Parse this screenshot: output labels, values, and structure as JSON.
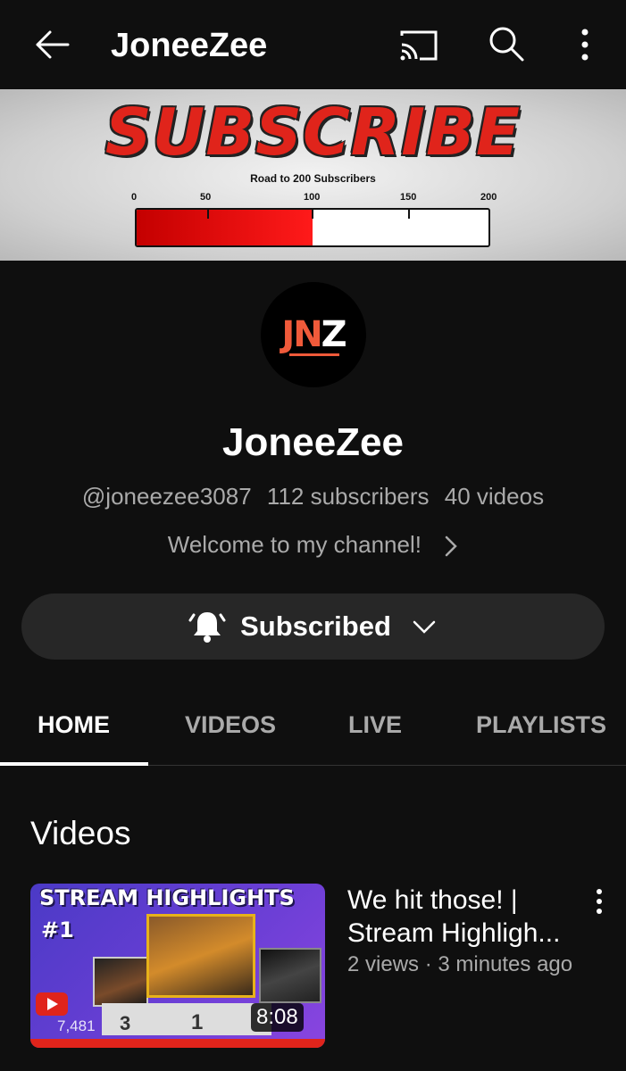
{
  "topbar": {
    "title": "JoneeZee",
    "icons": [
      "back-arrow-icon",
      "cast-icon",
      "search-icon",
      "more-vert-icon"
    ]
  },
  "banner": {
    "headline": "SUBSCRIBE",
    "goal_text": "Road to 200 Subscribers",
    "ticks": [
      "0",
      "50",
      "100",
      "150",
      "200"
    ],
    "progress_value": 100,
    "progress_max": 200,
    "fill_color": "#e0241b"
  },
  "avatar": {
    "logo_part1": "JN",
    "logo_part2": "Z",
    "accent": "#f05a3a"
  },
  "channel": {
    "name": "JoneeZee",
    "handle": "@joneezee3087",
    "subscribers": "112 subscribers",
    "videos": "40 videos",
    "description": "Welcome to my channel!"
  },
  "subscribe_button": {
    "label": "Subscribed"
  },
  "tabs": [
    {
      "label": "HOME",
      "active": true
    },
    {
      "label": "VIDEOS",
      "active": false
    },
    {
      "label": "LIVE",
      "active": false
    },
    {
      "label": "PLAYLISTS",
      "active": false
    }
  ],
  "section": {
    "title": "Videos"
  },
  "video": {
    "thumb_heading": "STREAM HIGHLIGHTS",
    "thumb_number": "#1",
    "thumb_small_text": "7,481",
    "podium_3": "3",
    "podium_1": "1",
    "duration": "8:08",
    "title": "We hit those! | Stream Highligh...",
    "meta": "2 views · 3 minutes ago"
  }
}
